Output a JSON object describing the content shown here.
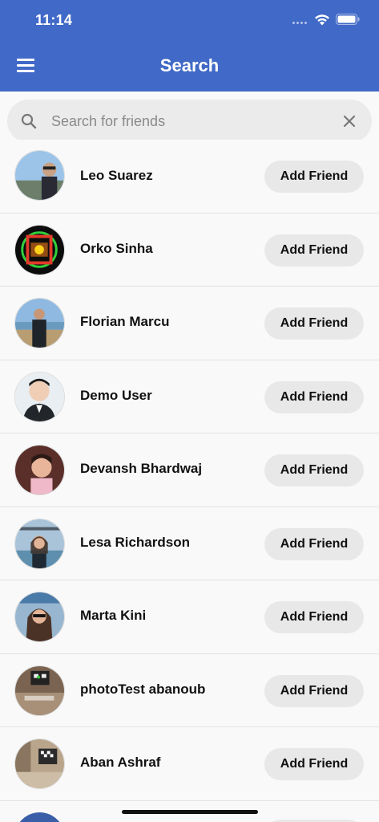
{
  "status_bar": {
    "time": "11:14"
  },
  "header": {
    "title": "Search"
  },
  "search": {
    "placeholder": "Search for friends",
    "value": ""
  },
  "users": [
    {
      "name": "Leo Suarez",
      "button": "Add Friend"
    },
    {
      "name": "Orko Sinha",
      "button": "Add Friend"
    },
    {
      "name": "Florian Marcu",
      "button": "Add Friend"
    },
    {
      "name": "Demo User",
      "button": "Add Friend"
    },
    {
      "name": "Devansh Bhardwaj",
      "button": "Add Friend"
    },
    {
      "name": "Lesa Richardson",
      "button": "Add Friend"
    },
    {
      "name": "Marta Kini",
      "button": "Add Friend"
    },
    {
      "name": "photoTest abanoub",
      "button": "Add Friend"
    },
    {
      "name": "Aban Ashraf",
      "button": "Add Friend"
    }
  ],
  "colors": {
    "header": "#4169c7",
    "button_bg": "#e8e8e8",
    "background": "#f9f9f9"
  },
  "icons": [
    "menu-icon",
    "search-icon",
    "clear-icon",
    "wifi-icon",
    "battery-icon"
  ]
}
